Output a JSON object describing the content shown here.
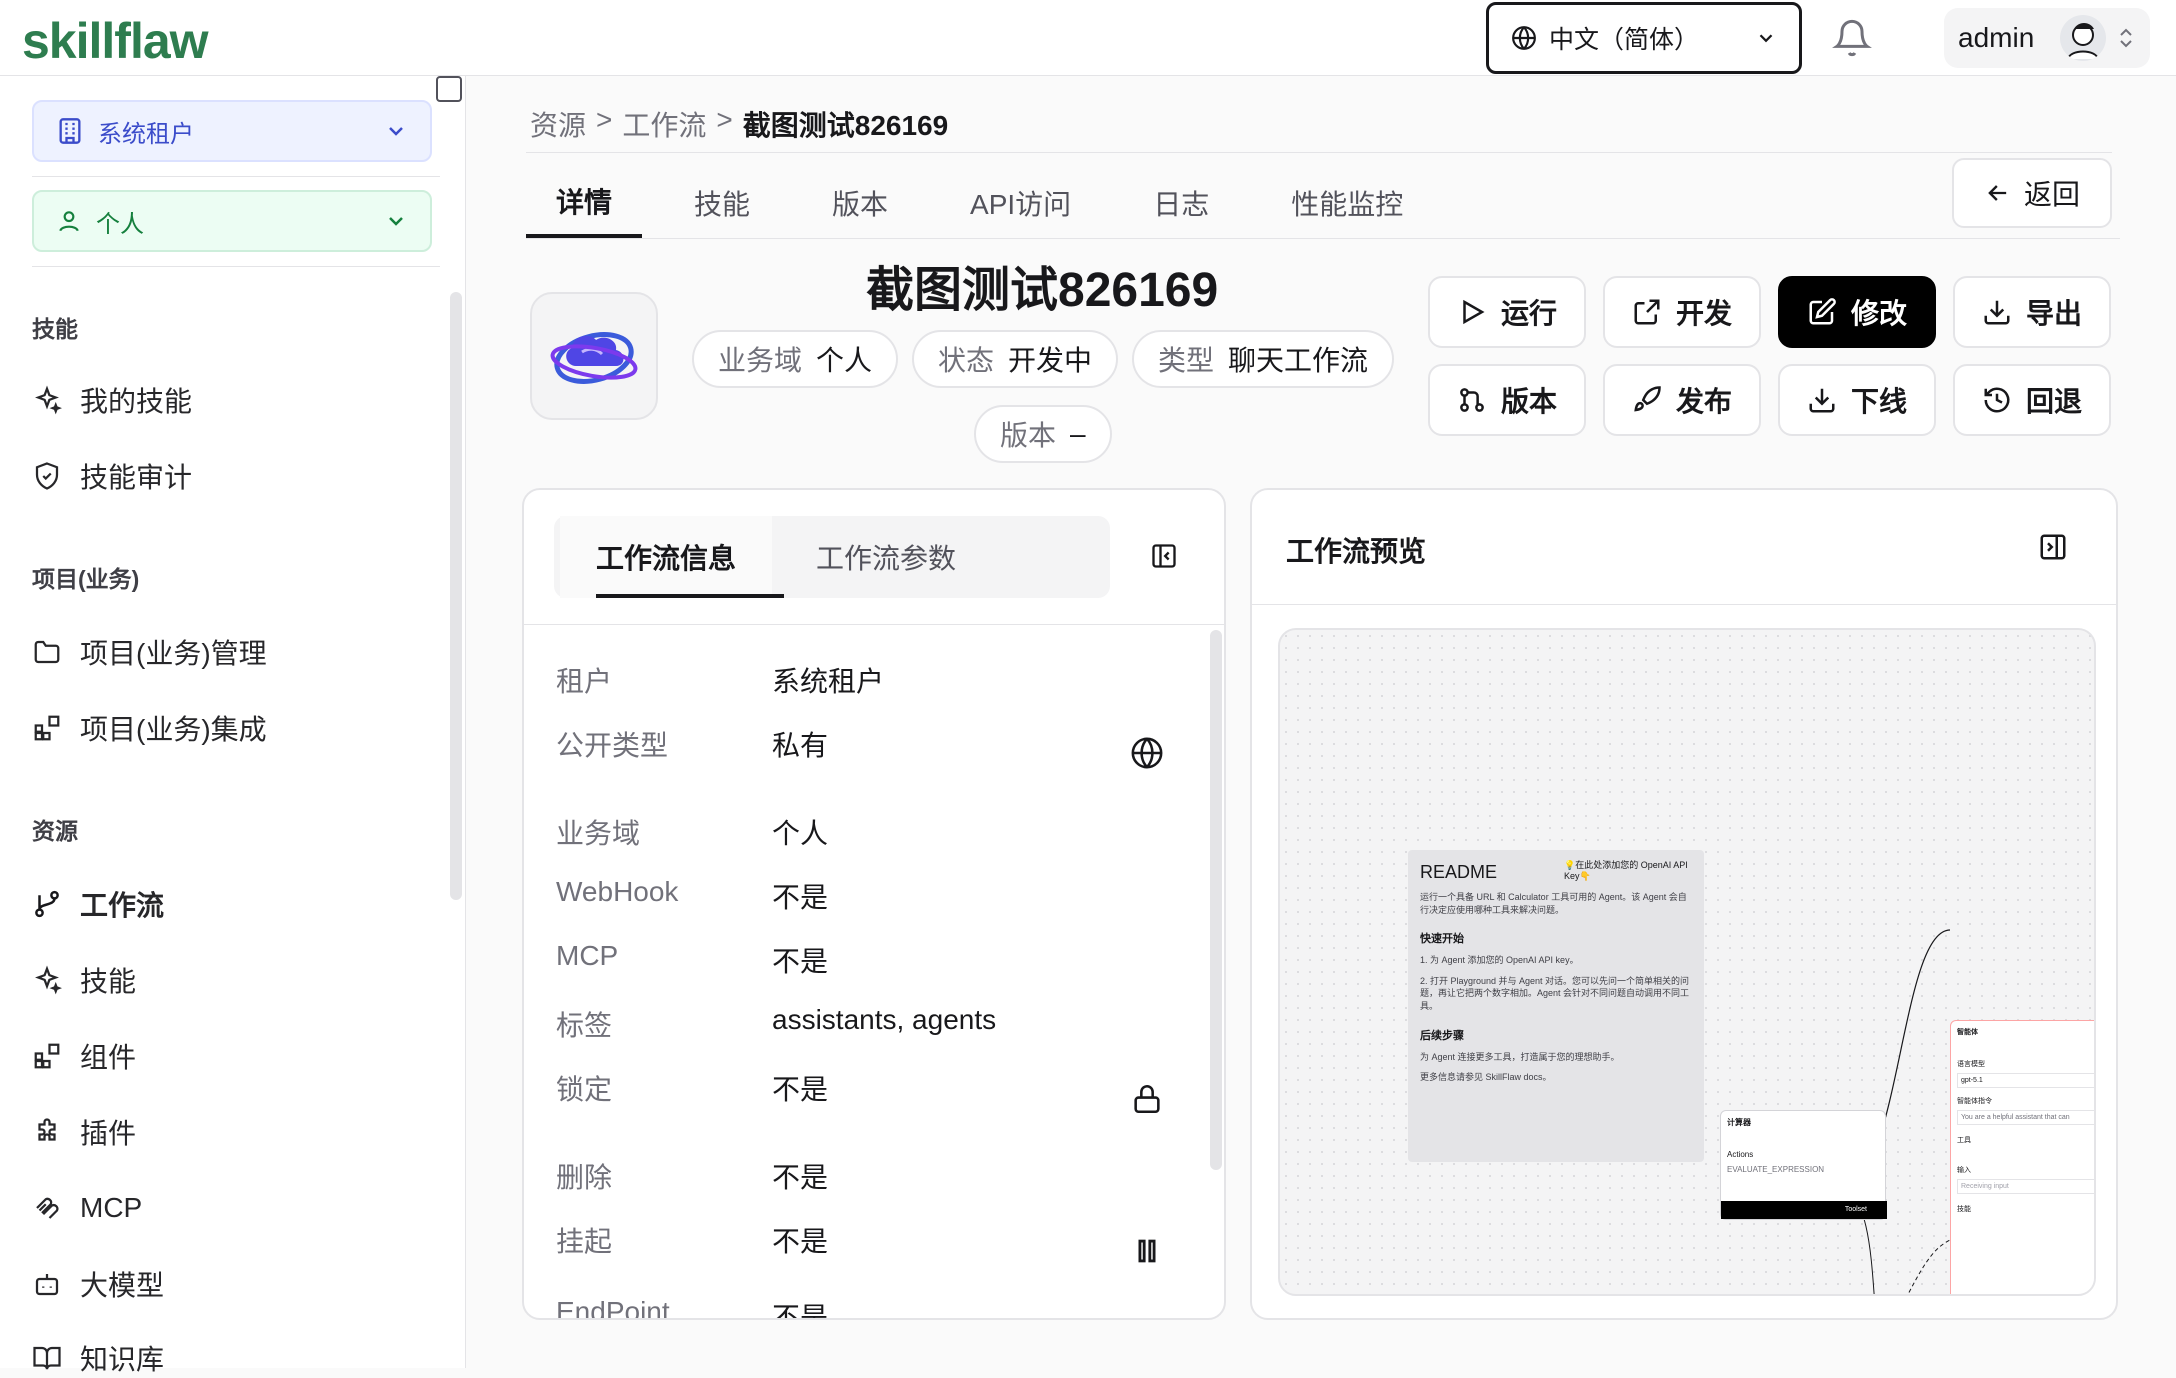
{
  "header": {
    "logo": "skillflaw",
    "language": "中文（简体）",
    "user": "admin"
  },
  "sidebar": {
    "tenant_select": "系统租户",
    "scope_select": "个人",
    "sections": [
      {
        "title": "技能",
        "items": [
          "我的技能",
          "技能审计"
        ]
      },
      {
        "title": "项目(业务)",
        "items": [
          "项目(业务)管理",
          "项目(业务)集成"
        ]
      },
      {
        "title": "资源",
        "items": [
          "工作流",
          "技能",
          "组件",
          "插件",
          "MCP",
          "大模型",
          "知识库"
        ]
      }
    ],
    "active_item": "工作流"
  },
  "breadcrumb": [
    "资源",
    "工作流",
    "截图测试826169"
  ],
  "breadcrumb_sep": ">",
  "tabs": [
    "详情",
    "技能",
    "版本",
    "API访问",
    "日志",
    "性能监控"
  ],
  "back_label": "返回",
  "workflow": {
    "title": "截图测试826169",
    "chips": [
      {
        "k": "业务域",
        "v": "个人"
      },
      {
        "k": "状态",
        "v": "开发中"
      },
      {
        "k": "类型",
        "v": "聊天工作流"
      },
      {
        "k": "版本",
        "v": "–"
      }
    ]
  },
  "actions": [
    "运行",
    "开发",
    "修改",
    "导出",
    "版本",
    "发布",
    "下线",
    "回退"
  ],
  "info_panel": {
    "tabs": [
      "工作流信息",
      "工作流参数"
    ],
    "rows": [
      {
        "k": "租户",
        "v": "系统租户"
      },
      {
        "k": "公开类型",
        "v": "私有"
      },
      {
        "k": "业务域",
        "v": "个人"
      },
      {
        "k": "WebHook",
        "v": "不是"
      },
      {
        "k": "MCP",
        "v": "不是"
      },
      {
        "k": "标签",
        "v": "assistants, agents"
      },
      {
        "k": "锁定",
        "v": "不是"
      },
      {
        "k": "删除",
        "v": "不是"
      },
      {
        "k": "挂起",
        "v": "不是"
      },
      {
        "k": "EndPoint",
        "v": "不是"
      }
    ]
  },
  "preview": {
    "title": "工作流预览",
    "readme": {
      "heading": "README",
      "hint": "💡在此处添加您的 OpenAI API Key👇",
      "intro": "运行一个具备 URL 和 Calculator 工具可用的 Agent。该 Agent 会自行决定应使用哪种工具来解决问题。",
      "quick_start": "快速开始",
      "step1": "1. 为 Agent 添加您的 OpenAI API key。",
      "step2": "2. 打开 Playground 并与 Agent 对话。您可以先问一个简单相关的问题，再让它把两个数字相加。Agent 会针对不同问题自动调用不同工具。",
      "next": "后续步骤",
      "next_text": "为 Agent 连接更多工具，打造属于您的理想助手。",
      "more": "更多信息请参见 SkillFlaw docs。"
    },
    "calc_node": {
      "title": "计算器",
      "actions": "Actions",
      "expr": "EVALUATE_EXPRESSION",
      "toolset": "Toolset"
    },
    "agent_node": {
      "title": "智能体",
      "model_label": "语言模型",
      "model": "gpt-5.1",
      "instr": "智能体指令",
      "instr_val": "You are a helpful assistant that can",
      "tools": "工具",
      "input": "输入",
      "input_ph": "Receiving input",
      "skills": "技能"
    }
  }
}
